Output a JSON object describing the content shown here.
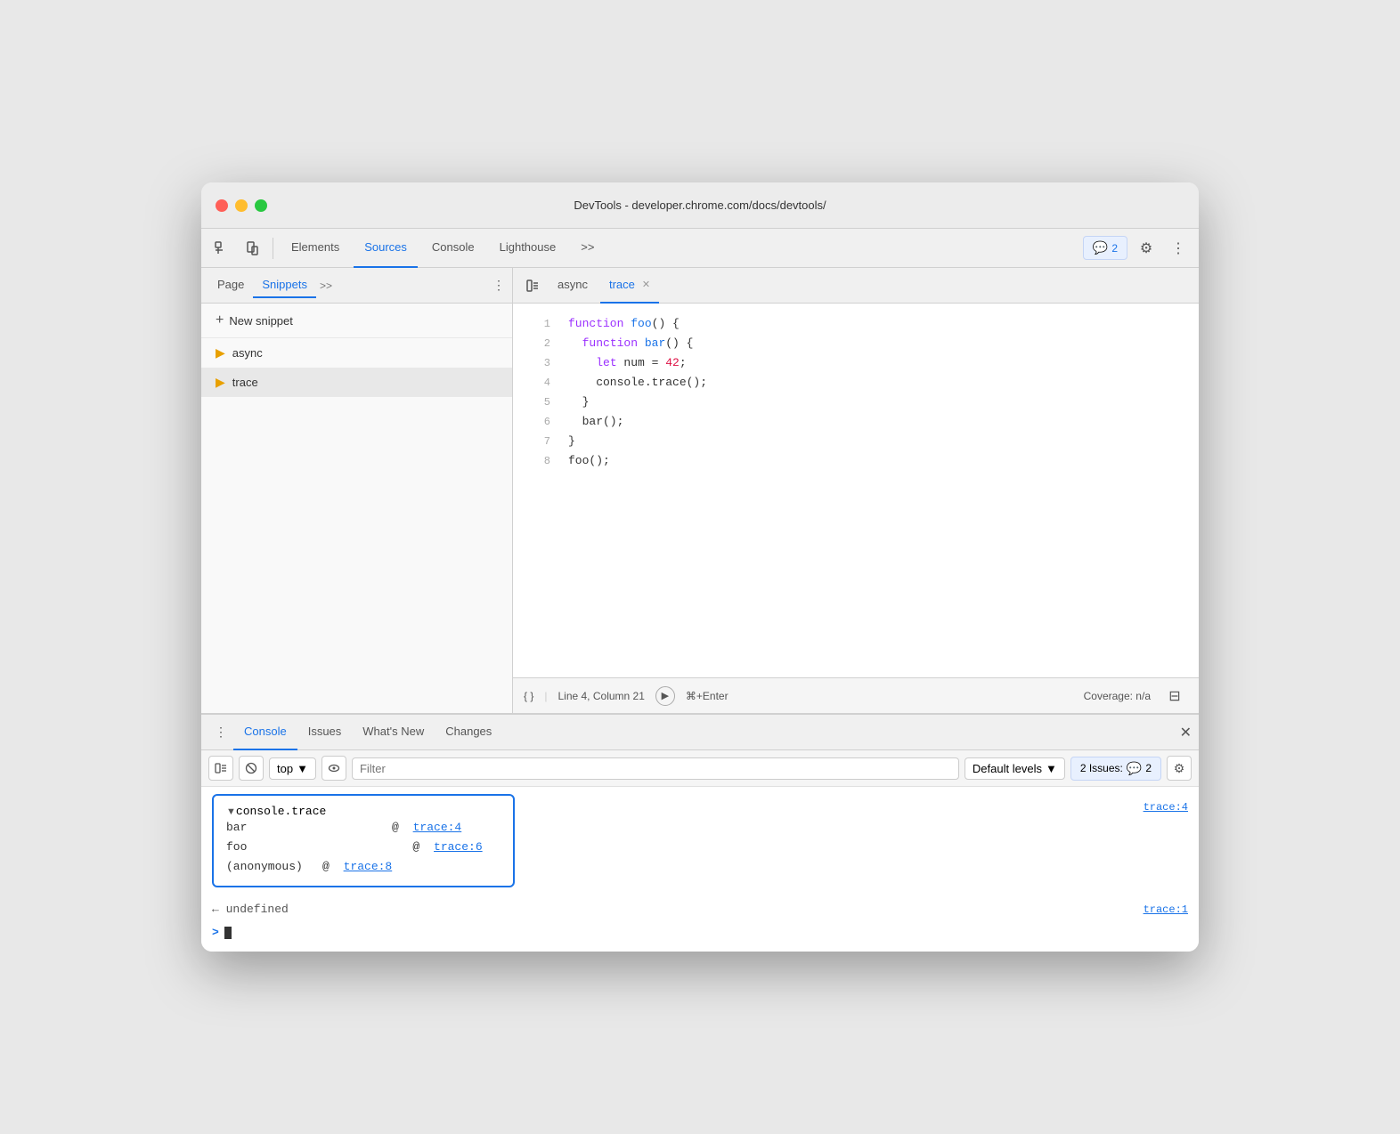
{
  "window": {
    "title": "DevTools - developer.chrome.com/docs/devtools/"
  },
  "toolbar": {
    "inspect_label": "Inspect",
    "device_label": "Device",
    "tabs": [
      {
        "label": "Elements",
        "active": false
      },
      {
        "label": "Sources",
        "active": true
      },
      {
        "label": "Console",
        "active": false
      },
      {
        "label": "Lighthouse",
        "active": false
      }
    ],
    "more_label": ">>",
    "issues_badge": "2",
    "settings_label": "⚙",
    "menu_label": "⋮"
  },
  "sidebar": {
    "tabs": [
      {
        "label": "Page",
        "active": false
      },
      {
        "label": "Snippets",
        "active": true
      }
    ],
    "more_label": ">>",
    "new_snippet_label": "New snippet",
    "snippets": [
      {
        "name": "async",
        "selected": false
      },
      {
        "name": "trace",
        "selected": true
      }
    ]
  },
  "editor": {
    "tabs": [
      {
        "label": "async",
        "active": false,
        "closable": false
      },
      {
        "label": "trace",
        "active": true,
        "closable": true
      }
    ],
    "code_lines": [
      {
        "num": 1,
        "text": "function foo() {"
      },
      {
        "num": 2,
        "text": "  function bar() {"
      },
      {
        "num": 3,
        "text": "    let num = 42;"
      },
      {
        "num": 4,
        "text": "    console.trace();"
      },
      {
        "num": 5,
        "text": "  }"
      },
      {
        "num": 6,
        "text": "  bar();"
      },
      {
        "num": 7,
        "text": "}"
      },
      {
        "num": 8,
        "text": "foo();"
      }
    ],
    "status": {
      "format_label": "{ }",
      "position": "Line 4, Column 21",
      "run_label": "⌘+Enter",
      "coverage": "Coverage: n/a"
    }
  },
  "console": {
    "tabs": [
      {
        "label": "Console",
        "active": true
      },
      {
        "label": "Issues",
        "active": false
      },
      {
        "label": "What's New",
        "active": false
      },
      {
        "label": "Changes",
        "active": false
      }
    ],
    "toolbar": {
      "clear_label": "🚫",
      "context_label": "top",
      "eye_label": "👁",
      "filter_placeholder": "Filter",
      "levels_label": "Default levels",
      "issues_label": "2 Issues:",
      "issues_count": "2"
    },
    "trace_group": {
      "header": "console.trace",
      "ref": "trace:4",
      "rows": [
        {
          "func": "bar",
          "at": "@",
          "link": "trace:4"
        },
        {
          "func": "foo",
          "at": "@",
          "link": "trace:6"
        },
        {
          "func": "(anonymous)",
          "at": "@",
          "link": "trace:8"
        }
      ]
    },
    "output_row": {
      "text": "← undefined",
      "ref": "trace:1"
    },
    "input_prompt": ">",
    "input_text": ""
  }
}
